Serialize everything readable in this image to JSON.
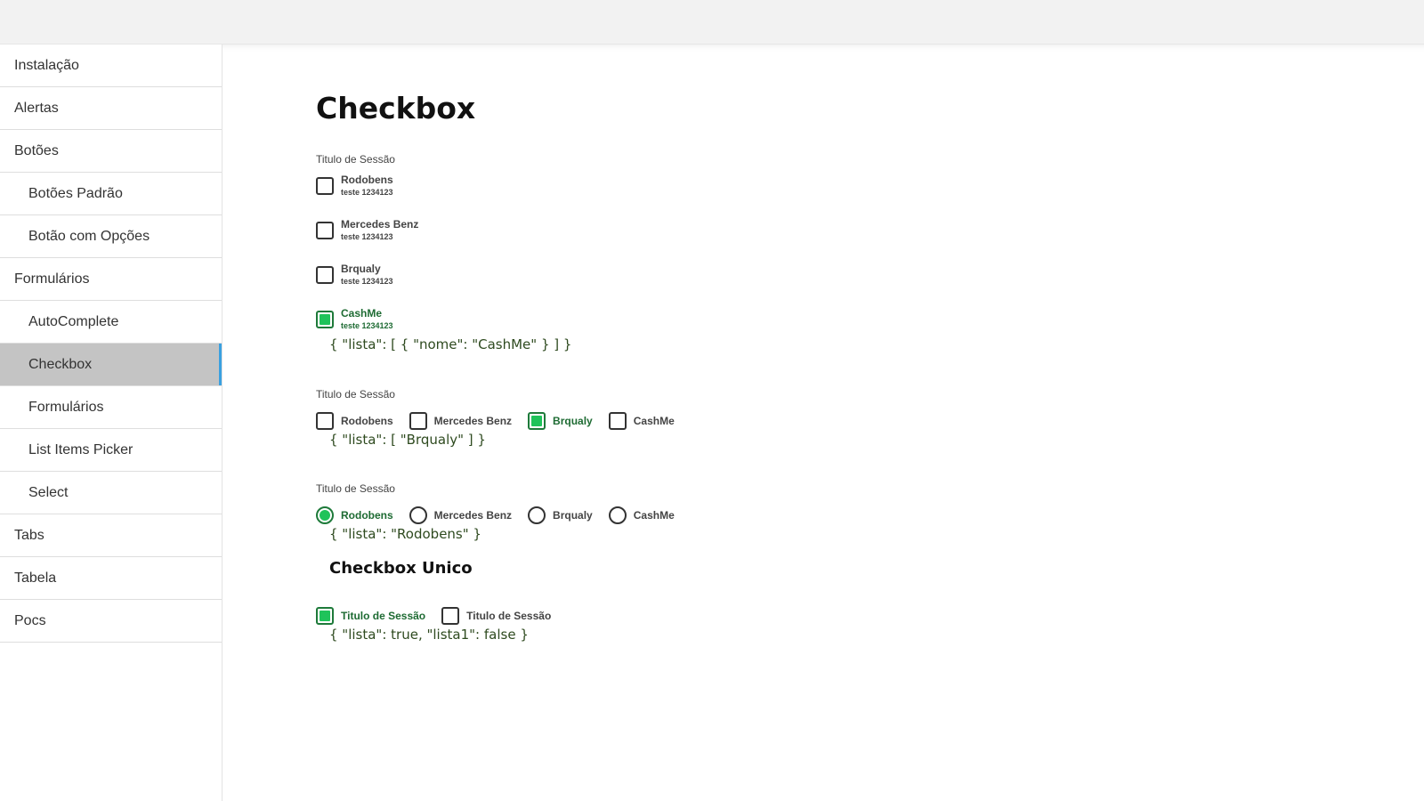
{
  "sidebar": {
    "items": [
      {
        "label": "Instalação",
        "sub": false,
        "active": false
      },
      {
        "label": "Alertas",
        "sub": false,
        "active": false
      },
      {
        "label": "Botões",
        "sub": false,
        "active": false
      },
      {
        "label": "Botões Padrão",
        "sub": true,
        "active": false
      },
      {
        "label": "Botão com Opções",
        "sub": true,
        "active": false
      },
      {
        "label": "Formulários",
        "sub": false,
        "active": false
      },
      {
        "label": "AutoComplete",
        "sub": true,
        "active": false
      },
      {
        "label": "Checkbox",
        "sub": true,
        "active": true
      },
      {
        "label": "Formulários",
        "sub": true,
        "active": false
      },
      {
        "label": "List Items Picker",
        "sub": true,
        "active": false
      },
      {
        "label": "Select",
        "sub": true,
        "active": false
      },
      {
        "label": "Tabs",
        "sub": false,
        "active": false
      },
      {
        "label": "Tabela",
        "sub": false,
        "active": false
      },
      {
        "label": "Pocs",
        "sub": false,
        "active": false
      }
    ]
  },
  "main": {
    "title": "Checkbox",
    "section1": {
      "label": "Titulo de Sessão",
      "options": [
        {
          "name": "Rodobens",
          "desc": "teste 1234123",
          "checked": false
        },
        {
          "name": "Mercedes Benz",
          "desc": "teste 1234123",
          "checked": false
        },
        {
          "name": "Brqualy",
          "desc": "teste 1234123",
          "checked": false
        },
        {
          "name": "CashMe",
          "desc": "teste 1234123",
          "checked": true
        }
      ],
      "json": "{ \"lista\": [ { \"nome\": \"CashMe\" } ] }"
    },
    "section2": {
      "label": "Titulo de Sessão",
      "options": [
        {
          "name": "Rodobens",
          "checked": false
        },
        {
          "name": "Mercedes Benz",
          "checked": false
        },
        {
          "name": "Brqualy",
          "checked": true
        },
        {
          "name": "CashMe",
          "checked": false
        }
      ],
      "json": "{ \"lista\": [ \"Brqualy\" ] }"
    },
    "section3": {
      "label": "Titulo de Sessão",
      "options": [
        {
          "name": "Rodobens",
          "checked": true
        },
        {
          "name": "Mercedes Benz",
          "checked": false
        },
        {
          "name": "Brqualy",
          "checked": false
        },
        {
          "name": "CashMe",
          "checked": false
        }
      ],
      "json": "{ \"lista\": \"Rodobens\" }"
    },
    "section4": {
      "title": "Checkbox Unico",
      "options": [
        {
          "name": "Titulo de Sessão",
          "checked": true
        },
        {
          "name": "Titulo de Sessão",
          "checked": false
        }
      ],
      "json": "{ \"lista\": true, \"lista1\": false }"
    }
  },
  "colors": {
    "accent": "#1fc35a",
    "active_border": "#3aa0e0",
    "checked_text": "#1e6b33"
  }
}
